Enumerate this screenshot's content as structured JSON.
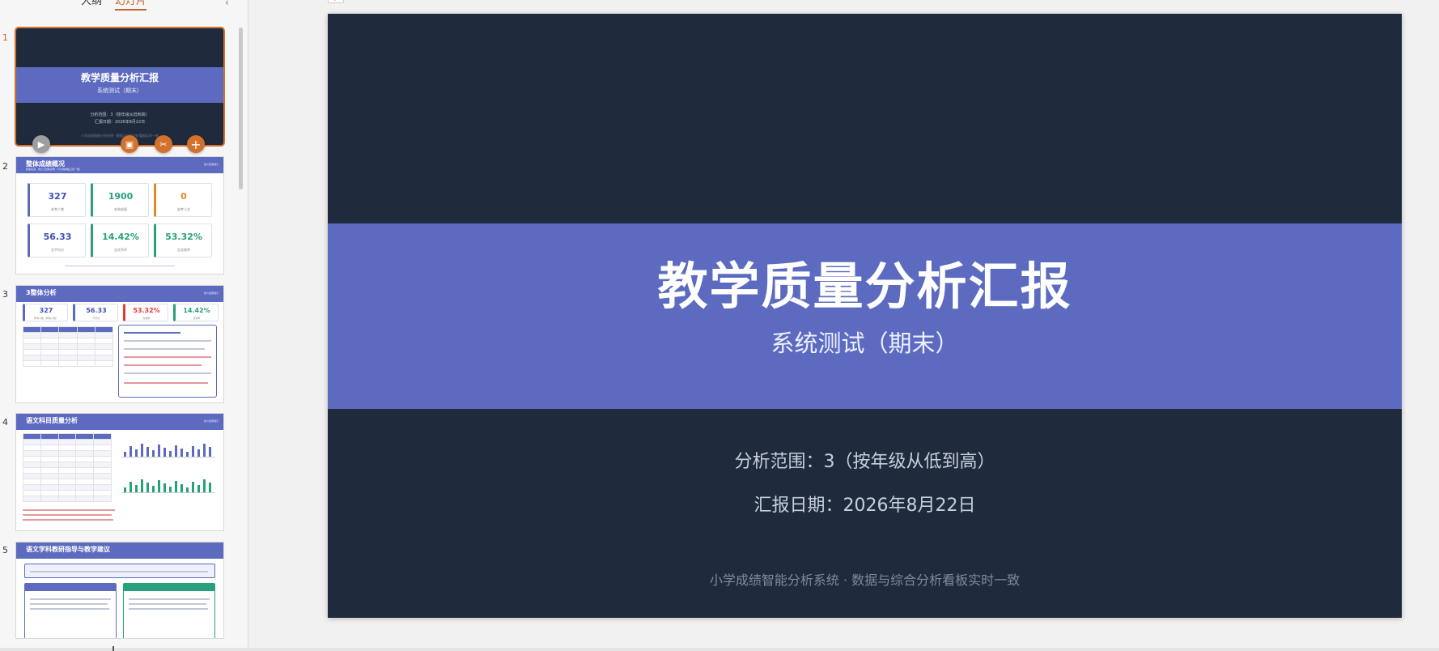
{
  "panel": {
    "tabs": [
      "大纲",
      "幻灯片"
    ],
    "active_tab": 1
  },
  "thumbnails": [
    {
      "num": "1",
      "title": "教学质量分析汇报",
      "subtitle": "系统测试（期末）",
      "line1": "分析范围：3（按年级从低到高）",
      "line2": "汇报日期：2026年8月22日",
      "footer": "小学成绩智能分析系统 · 数据与综合分析看板实时一致"
    },
    {
      "num": "2",
      "title": "整体成绩概况",
      "subtitle": "数据来源、统计口径等说明（与系统看板口径一致）",
      "tag": "统计结果展示",
      "cards": [
        {
          "value": "327",
          "label": "参考人数",
          "color": "#3f51b5"
        },
        {
          "value": "1900",
          "label": "有效成绩",
          "color": "#26a17b"
        },
        {
          "value": "0",
          "label": "缺考人次",
          "color": "#e08a2c"
        },
        {
          "value": "56.33",
          "label": "总平均分",
          "color": "#3f51b5"
        },
        {
          "value": "14.42%",
          "label": "总优秀率",
          "color": "#26a17b"
        },
        {
          "value": "53.32%",
          "label": "总及格率",
          "color": "#26a17b"
        }
      ]
    },
    {
      "num": "3",
      "title": "3整体分析",
      "tag": "统计结果展示",
      "cards": [
        {
          "value": "327",
          "label": "参考人数（有效人数）",
          "color": "#3f51b5"
        },
        {
          "value": "56.33",
          "label": "平均分",
          "color": "#3f51b5"
        },
        {
          "value": "53.32%",
          "label": "及格率",
          "color": "#e53935"
        },
        {
          "value": "14.42%",
          "label": "优秀率",
          "color": "#26a17b"
        }
      ]
    },
    {
      "num": "4",
      "title": "语文科目质量分析",
      "tag": "统计结果展示"
    },
    {
      "num": "5",
      "title": "语文学科教研指导与教学建议",
      "tag": ""
    }
  ],
  "slide": {
    "icon_label": "P",
    "title": "教学质量分析汇报",
    "subtitle": "系统测试（期末）",
    "scope": "分析范围：3（按年级从低到高）",
    "date": "汇报日期：2026年8月22日",
    "footer": "小学成绩智能分析系统 · 数据与综合分析看板实时一致"
  },
  "colors": {
    "slide_bg": "#1f2a3c",
    "band": "#5c6bc0",
    "accent_orange": "#d2712c",
    "green": "#26a17b"
  },
  "toolbar_icons": [
    "play-icon",
    "image-edit-icon",
    "magic-tools-icon",
    "add-icon"
  ]
}
